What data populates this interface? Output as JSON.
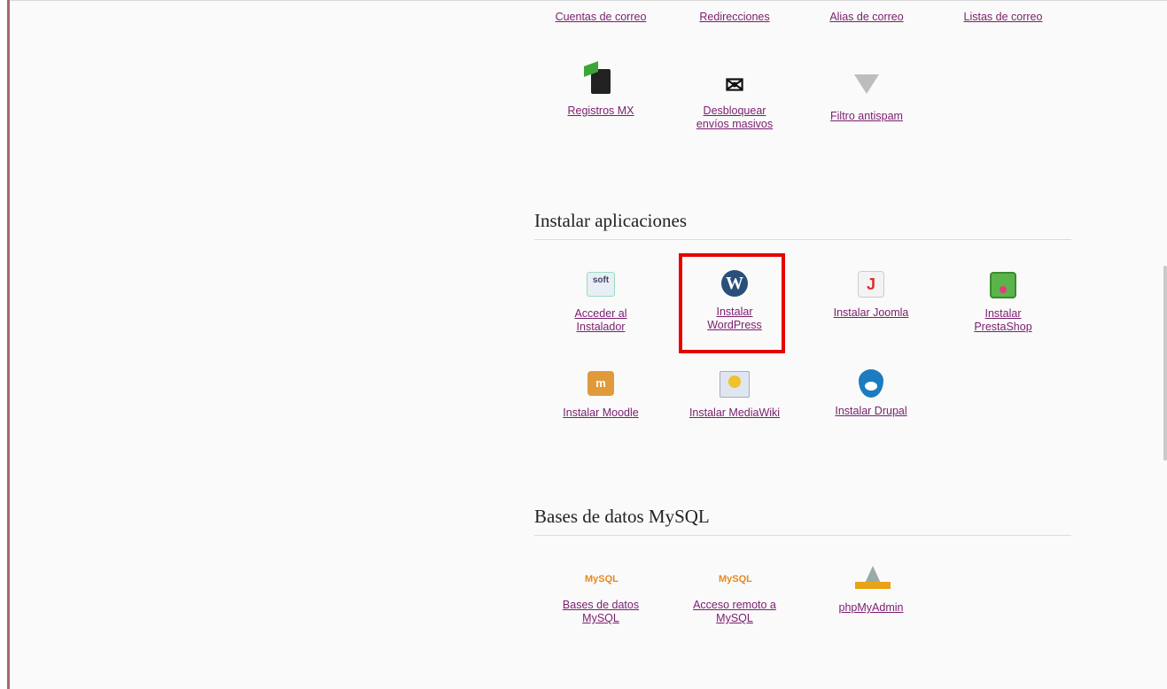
{
  "email_links": [
    "Cuentas de correo",
    "Redirecciones",
    "Alias de correo",
    "Listas de correo"
  ],
  "email_tools": [
    {
      "label": "Registros MX",
      "icon": "mx-server-icon"
    },
    {
      "label": "Desbloquear envíos masivos",
      "label_line1": "Desbloquear",
      "label_line2": "envíos masivos",
      "icon": "bulk-mail-icon"
    },
    {
      "label": "Filtro antispam",
      "icon": "antispam-filter-icon"
    }
  ],
  "apps_section": {
    "title": "Instalar aplicaciones",
    "items": [
      {
        "line1": "Acceder al",
        "line2": "Instalador",
        "icon": "softaculous-icon"
      },
      {
        "line1": "Instalar",
        "line2": "WordPress",
        "icon": "wordpress-icon"
      },
      {
        "line1": "Instalar Joomla",
        "line2": "",
        "icon": "joomla-icon"
      },
      {
        "line1": "Instalar",
        "line2": "PrestaShop",
        "icon": "prestashop-icon"
      },
      {
        "line1": "Instalar Moodle",
        "line2": "",
        "icon": "moodle-icon"
      },
      {
        "line1": "Instalar MediaWiki",
        "line2": "",
        "icon": "mediawiki-icon"
      },
      {
        "line1": "Instalar Drupal",
        "line2": "",
        "icon": "drupal-icon"
      }
    ],
    "highlight_color": "#e60000"
  },
  "mysql_section": {
    "title": "Bases de datos MySQL",
    "items": [
      {
        "line1": "Bases de datos",
        "line2": "MySQL",
        "icon": "mysql-icon"
      },
      {
        "line1": "Acceso remoto a",
        "line2": "MySQL",
        "icon": "mysql-remote-icon"
      },
      {
        "line1": "phpMyAdmin",
        "line2": "",
        "icon": "phpmyadmin-icon"
      }
    ]
  },
  "icon_text": {
    "soft": "soft",
    "wordpress": "W",
    "joomla": "J",
    "moodle": "m",
    "mail": "✉",
    "mysql_a": "My",
    "mysql_b": "SQL"
  },
  "colors": {
    "link": "#7a1e6e",
    "left_border": "#a06a6a"
  }
}
